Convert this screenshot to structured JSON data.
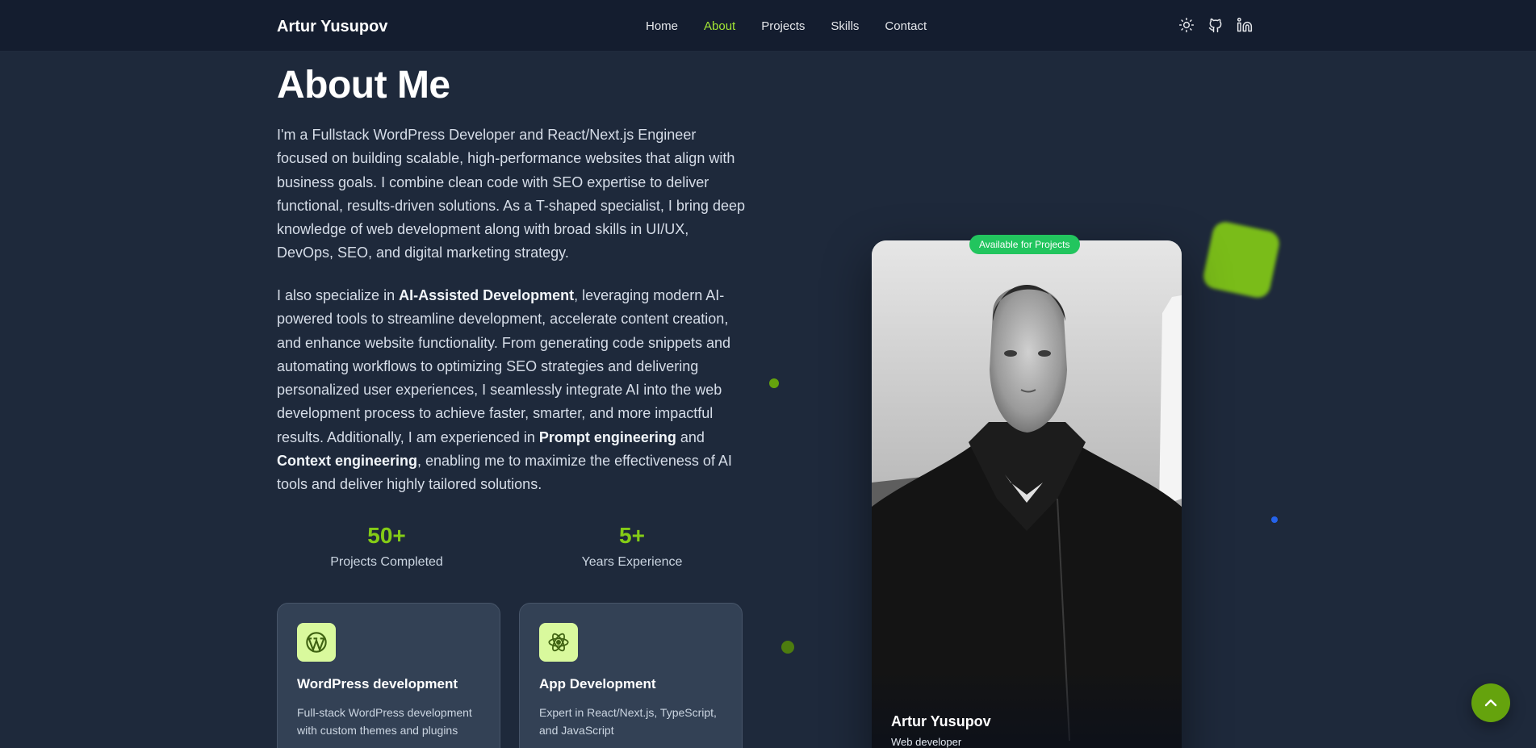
{
  "header": {
    "brand": "Artur Yusupov",
    "nav": [
      "Home",
      "About",
      "Projects",
      "Skills",
      "Contact"
    ],
    "active_nav": "About",
    "icons": [
      "sun-icon",
      "github-icon",
      "linkedin-icon"
    ]
  },
  "about": {
    "title": "About Me",
    "paragraph1": "I'm a Fullstack WordPress Developer and React/Next.js Engineer focused on building scalable, high-performance websites that align with business goals. I combine clean code with SEO expertise to deliver functional, results-driven solutions. As a T-shaped specialist, I bring deep knowledge of web development along with broad skills in UI/UX, DevOps, SEO, and digital marketing strategy.",
    "paragraph2": {
      "t1": "I also specialize in ",
      "b1": "AI-Assisted Development",
      "t2": ", leveraging modern AI-powered tools to streamline development, accelerate content creation, and enhance website functionality. From generating code snippets and automating workflows to optimizing SEO strategies and delivering personalized user experiences, I seamlessly integrate AI into the web development process to achieve faster, smarter, and more impactful results. Additionally, I am experienced in ",
      "b2": "Prompt engineering",
      "t3": " and ",
      "b3": "Context engineering",
      "t4": ", enabling me to maximize the effectiveness of AI tools and deliver highly tailored solutions."
    }
  },
  "stats": [
    {
      "value": "50+",
      "label": "Projects Completed"
    },
    {
      "value": "5+",
      "label": "Years Experience"
    }
  ],
  "cards": [
    {
      "icon": "wordpress-icon",
      "title": "WordPress development",
      "desc": "Full-stack WordPress development with custom themes and plugins"
    },
    {
      "icon": "react-icon",
      "title": "App Development",
      "desc": "Expert in React/Next.js, TypeScript, and JavaScript"
    }
  ],
  "profile": {
    "badge": "Available for Projects",
    "name": "Artur Yusupov",
    "role": "Web developer"
  },
  "colors": {
    "background": "#1e293b",
    "navbar": "#141d2f",
    "accent": "#84cc16",
    "badge": "#22c55e",
    "card": "#334155"
  }
}
